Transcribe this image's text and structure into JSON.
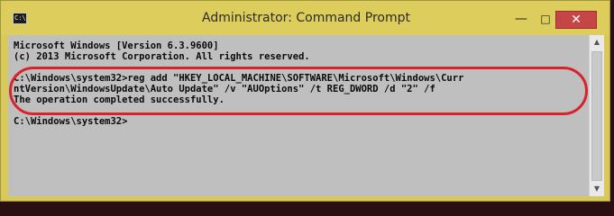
{
  "window": {
    "title": "Administrator: Command Prompt",
    "icon": "cmd-icon",
    "icon_glyph": "C:\\",
    "buttons": {
      "minimize": "—",
      "maximize": "□",
      "close": "✕"
    }
  },
  "console": {
    "lines": [
      "Microsoft Windows [Version 6.3.9600]",
      "(c) 2013 Microsoft Corporation. All rights reserved.",
      "",
      "C:\\Windows\\system32>reg add \"HKEY_LOCAL_MACHINE\\SOFTWARE\\Microsoft\\Windows\\Curr",
      "ntVersion\\WindowsUpdate\\Auto Update\" /v \"AUOptions\" /t REG_DWORD /d \"2\" /f",
      "The operation completed successfully.",
      "",
      "C:\\Windows\\system32>"
    ]
  },
  "scrollbar": {
    "up_arrow": "▲",
    "down_arrow": "▼"
  },
  "colors": {
    "titlebar": "#dccd5c",
    "console_bg": "#bfbfbf",
    "console_text": "#0a0a0a",
    "highlight": "#d8222c",
    "close_button": "#c54646"
  }
}
